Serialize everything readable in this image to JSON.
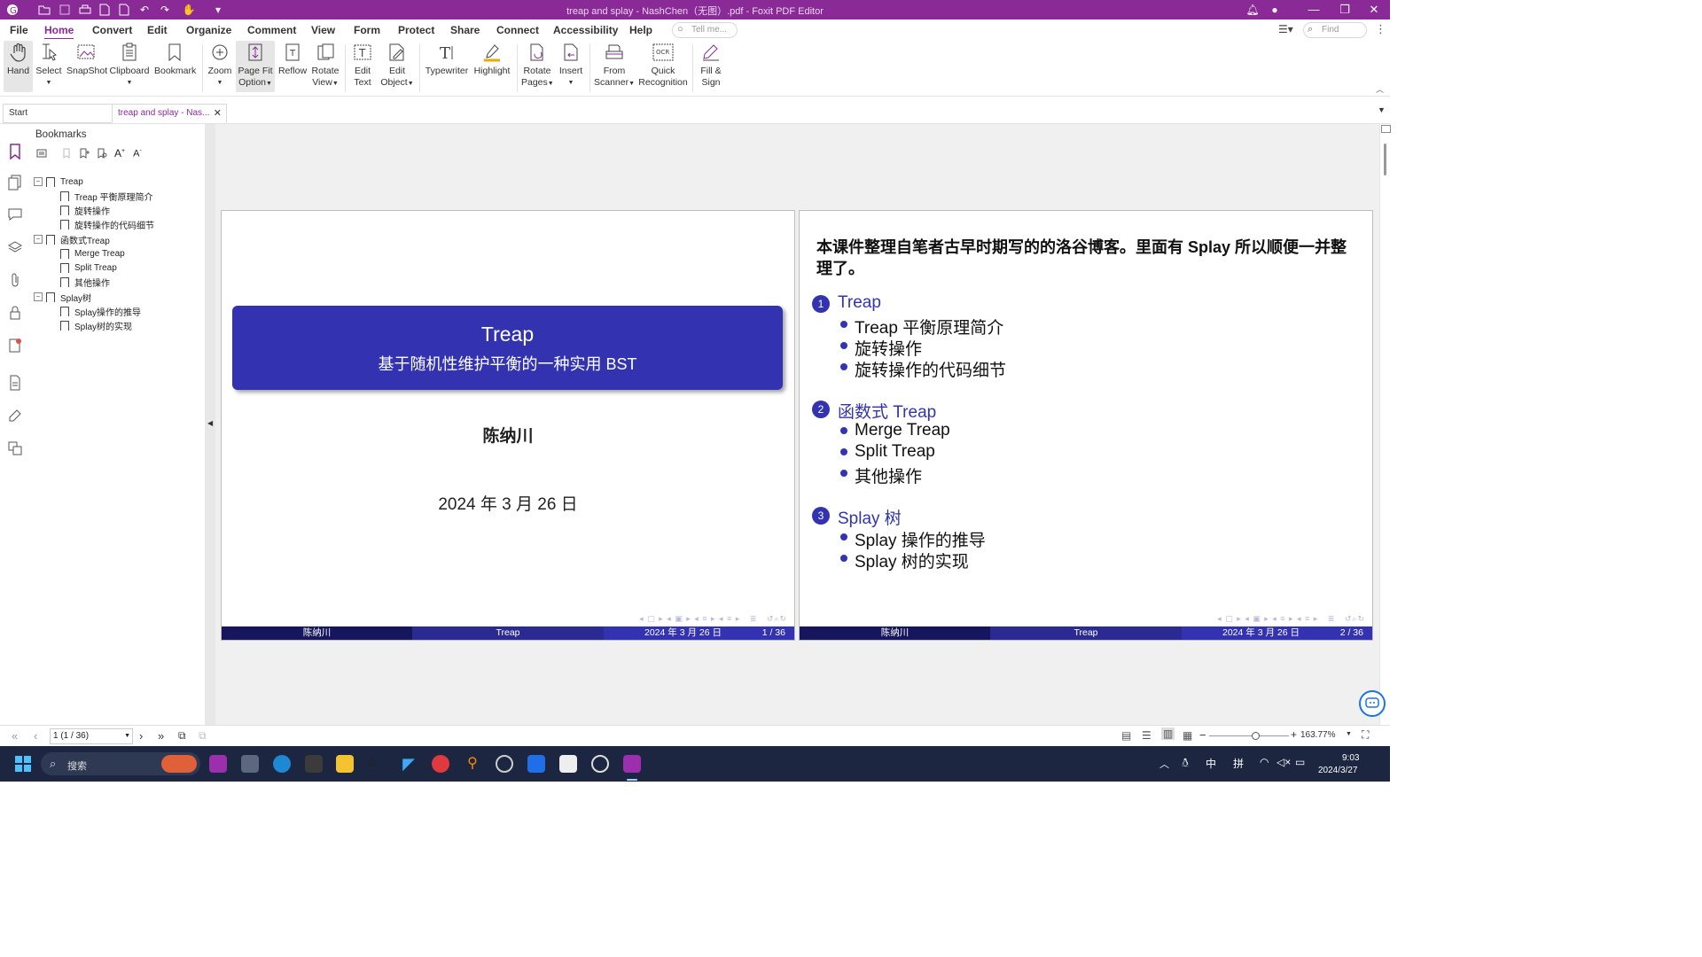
{
  "titlebar": {
    "title": "treap and splay - NashChen（无图）.pdf - Foxit PDF Editor"
  },
  "menu": [
    "File",
    "Home",
    "Convert",
    "Edit",
    "Organize",
    "Comment",
    "View",
    "Form",
    "Protect",
    "Share",
    "Connect",
    "Accessibility",
    "Help"
  ],
  "search": {
    "tell_me": "Tell me...",
    "find": "Find"
  },
  "ribbon": {
    "hand": "Hand",
    "select": "Select",
    "snapshot": "SnapShot",
    "clipboard": "Clipboard",
    "bookmark": "Bookmark",
    "zoom": "Zoom",
    "page_fit_1": "Page Fit",
    "page_fit_2": "Option",
    "reflow": "Reflow",
    "rotate_view_1": "Rotate",
    "rotate_view_2": "View",
    "edit_text_1": "Edit",
    "edit_text_2": "Text",
    "edit_object_1": "Edit",
    "edit_object_2": "Object",
    "typewriter": "Typewriter",
    "highlight": "Highlight",
    "rotate_pages_1": "Rotate",
    "rotate_pages_2": "Pages",
    "insert": "Insert",
    "from_scanner_1": "From",
    "from_scanner_2": "Scanner",
    "quick_rec_1": "Quick",
    "quick_rec_2": "Recognition",
    "fill_sign_1": "Fill &",
    "fill_sign_2": "Sign"
  },
  "tabs": {
    "start": "Start",
    "doc": "treap and splay - Nas..."
  },
  "bookmarks": {
    "header": "Bookmarks",
    "items": [
      {
        "label": "Treap",
        "level": 0
      },
      {
        "label": "Treap 平衡原理简介",
        "level": 1
      },
      {
        "label": "旋转操作",
        "level": 1
      },
      {
        "label": "旋转操作的代码细节",
        "level": 1
      },
      {
        "label": "函数式Treap",
        "level": 0
      },
      {
        "label": "Merge Treap",
        "level": 1
      },
      {
        "label": "Split Treap",
        "level": 1
      },
      {
        "label": "其他操作",
        "level": 1
      },
      {
        "label": "Splay树",
        "level": 0
      },
      {
        "label": "Splay操作的推导",
        "level": 1
      },
      {
        "label": "Splay树的实现",
        "level": 1
      }
    ]
  },
  "page1": {
    "title": "Treap",
    "subtitle": "基于随机性维护平衡的一种实用 BST",
    "author": "陈纳川",
    "date": "2024 年 3 月 26 日",
    "footer": {
      "author": "陈纳川",
      "title": "Treap",
      "date": "2024 年 3 月 26 日",
      "page": "1 / 36"
    }
  },
  "page2": {
    "intro": "本课件整理自笔者古早时期写的的洛谷博客。里面有 Splay 所以顺便一并整理了。",
    "sections": [
      {
        "num": "1",
        "title": "Treap",
        "items": [
          "Treap 平衡原理简介",
          "旋转操作",
          "旋转操作的代码细节"
        ]
      },
      {
        "num": "2",
        "title": "函数式 Treap",
        "items": [
          "Merge Treap",
          "Split Treap",
          "其他操作"
        ]
      },
      {
        "num": "3",
        "title": "Splay 树",
        "items": [
          "Splay 操作的推导",
          "Splay 树的实现"
        ]
      }
    ],
    "footer": {
      "author": "陈纳川",
      "title": "Treap",
      "date": "2024 年 3 月 26 日",
      "page": "2 / 36"
    }
  },
  "status": {
    "page_field": "1 (1 / 36)",
    "zoom": "163.77%"
  },
  "taskbar": {
    "search": "搜索",
    "ime1": "中",
    "ime2": "拼",
    "time": "9:03",
    "date": "2024/3/27"
  },
  "colors": {
    "brand": "#8a2a96",
    "beamer": "#3333b2",
    "footer_dark": "#16165e"
  }
}
